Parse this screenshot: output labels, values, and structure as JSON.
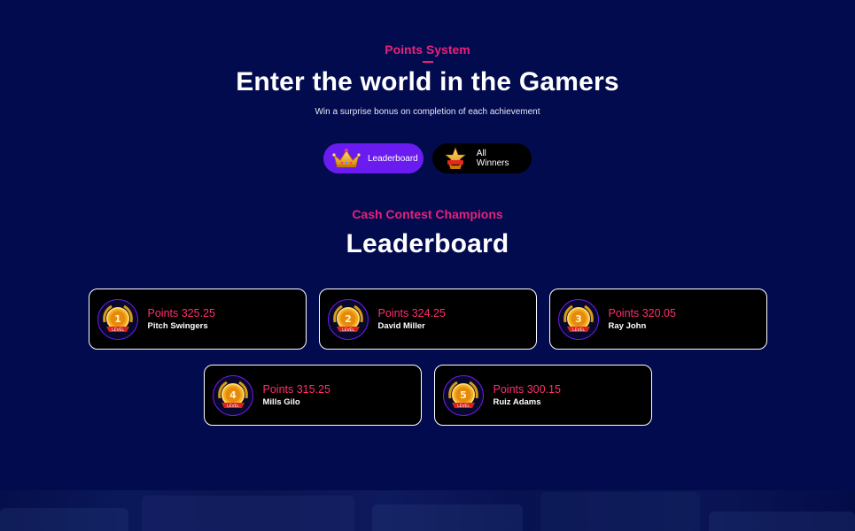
{
  "points_section": {
    "eyebrow": "Points System",
    "title": "Enter the world in the Gamers",
    "subtitle": "Win a surprise bonus on completion of each achievement"
  },
  "tabs": [
    {
      "label": "Leaderboard",
      "icon": "crown-icon",
      "active": true
    },
    {
      "label": "All Winners",
      "icon": "star-trophy-icon",
      "active": false
    }
  ],
  "leaderboard": {
    "eyebrow": "Cash Contest Champions",
    "title": "Leaderboard",
    "entries": [
      {
        "rank": "1",
        "points": "Points 325.25",
        "name": "Pitch Swingers"
      },
      {
        "rank": "2",
        "points": "Points 324.25",
        "name": "David Miller"
      },
      {
        "rank": "3",
        "points": "Points 320.05",
        "name": "Ray John"
      },
      {
        "rank": "4",
        "points": "Points 315.25",
        "name": "Mills Gilo"
      },
      {
        "rank": "5",
        "points": "Points 300.15",
        "name": "Ruiz Adams"
      }
    ],
    "medal_label": "LEVEL"
  },
  "colors": {
    "background": "#030b4f",
    "accent_pink": "#e6217a",
    "points_red": "#ff2f6e",
    "active_tab": "#6a1cf0"
  }
}
